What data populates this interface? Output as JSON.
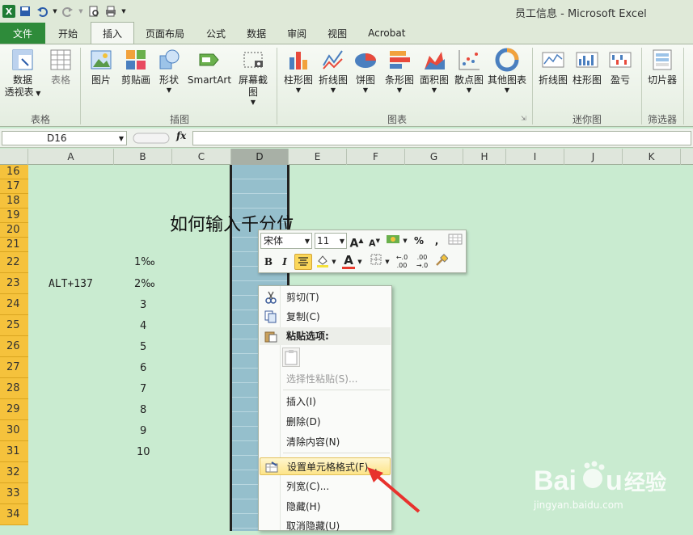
{
  "window": {
    "title": "员工信息 - Microsoft Excel"
  },
  "ribbon_tabs": [
    "文件",
    "开始",
    "插入",
    "页面布局",
    "公式",
    "数据",
    "审阅",
    "视图",
    "Acrobat"
  ],
  "active_tab": "插入",
  "ribbon": {
    "table_group": {
      "label": "表格",
      "buttons": [
        {
          "l1": "数据",
          "l2": "透视表"
        },
        {
          "l1": "表格"
        }
      ]
    },
    "illustrations_group": {
      "label": "插图",
      "buttons": [
        "图片",
        "剪贴画",
        "形状",
        "SmartArt",
        "屏幕截图"
      ]
    },
    "charts_group": {
      "label": "图表",
      "buttons": [
        "柱形图",
        "折线图",
        "饼图",
        "条形图",
        "面积图",
        "散点图",
        "其他图表"
      ]
    },
    "sparklines_group": {
      "label": "迷你图",
      "buttons": [
        "折线图",
        "柱形图",
        "盈亏"
      ]
    },
    "filter_group": {
      "label": "筛选器",
      "buttons": [
        "切片器"
      ]
    }
  },
  "formula_bar": {
    "name_box": "D16",
    "fx": "fx"
  },
  "columns": [
    "A",
    "B",
    "C",
    "D",
    "E",
    "F",
    "G",
    "H",
    "I",
    "J",
    "K"
  ],
  "rows": [
    "16",
    "17",
    "18",
    "19",
    "20",
    "21",
    "22",
    "23",
    "24",
    "25",
    "26",
    "27",
    "28",
    "29",
    "30",
    "31",
    "32",
    "33",
    "34"
  ],
  "cells": {
    "title": "如何输入千分位",
    "a23": "ALT+137",
    "b_values": [
      "1‰",
      "2‰",
      "3",
      "4",
      "5",
      "6",
      "7",
      "8",
      "9",
      "10"
    ]
  },
  "mini_toolbar": {
    "font": "宋体",
    "size": "11",
    "grow": "A",
    "shrink": "A",
    "percent": "%",
    "comma": ",",
    "bold": "B",
    "italic": "I",
    "font_color": "A"
  },
  "context_menu": [
    {
      "label": "剪切(T)",
      "state": "normal"
    },
    {
      "label": "复制(C)",
      "state": "normal"
    },
    {
      "label": "粘贴选项:",
      "state": "header"
    },
    {
      "label": "选择性粘贴(S)...",
      "state": "disabled"
    },
    {
      "label": "插入(I)",
      "state": "normal"
    },
    {
      "label": "删除(D)",
      "state": "normal"
    },
    {
      "label": "清除内容(N)",
      "state": "normal"
    },
    {
      "label": "设置单元格格式(F)...",
      "state": "highlighted"
    },
    {
      "label": "列宽(C)...",
      "state": "normal"
    },
    {
      "label": "隐藏(H)",
      "state": "normal"
    },
    {
      "label": "取消隐藏(U)",
      "state": "normal"
    }
  ],
  "watermark": {
    "brand": "Baidu经验",
    "url": "jingyan.baidu.com"
  },
  "colors": {
    "accent": "#2e8b3a",
    "sheet_bg": "#c9ebd0",
    "row_header": "#f5c23c",
    "selected_column": "#95bfcc",
    "highlight": "#fde488",
    "arrow": "#e8322d"
  }
}
